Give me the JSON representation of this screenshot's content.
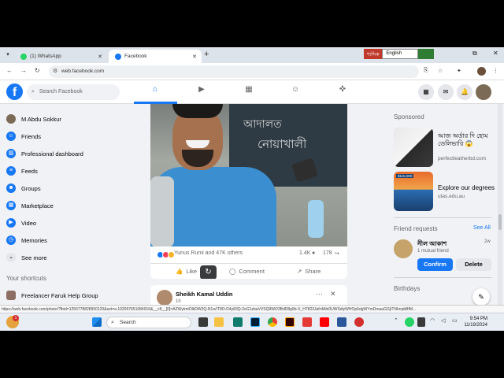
{
  "browser": {
    "tabs": [
      {
        "label": "(1) WhatsApp",
        "favicon_color": "#25d366"
      },
      {
        "label": "Facebook",
        "favicon_color": "#1877f2"
      }
    ],
    "url": "web.facebook.com",
    "ime": {
      "bangla": "শাব্দিক",
      "english": "English"
    },
    "status_url": "https://web.facebook.com/photo/?fbid=1256778828950120&set=a.102097651084916&__cft__[0]=AZWytmtOlkDW2Q-N1o//T8O-D4y83Q-2eG1zbaVVSQ9Wi23BdD8g9b-X_H7823Jafr4Ahi0UWSdiyWHOp6dgWYmDmaaGGjITNImpbBfM..."
  },
  "fb": {
    "brand_color": "#1877f2",
    "search_placeholder": "Search Facebook",
    "sidebar": [
      {
        "label": "M Abdu Sokkur",
        "icon": "avatar",
        "color": "#7b6a55"
      },
      {
        "label": "Friends",
        "icon": "friends-icon",
        "color": "#1877f2"
      },
      {
        "label": "Professional dashboard",
        "icon": "dashboard-icon",
        "color": "#1877f2"
      },
      {
        "label": "Feeds",
        "icon": "feeds-icon",
        "color": "#1877f2"
      },
      {
        "label": "Groups",
        "icon": "groups-icon",
        "color": "#1877f2"
      },
      {
        "label": "Marketplace",
        "icon": "marketplace-icon",
        "color": "#1877f2"
      },
      {
        "label": "Video",
        "icon": "video-icon",
        "color": "#1877f2"
      },
      {
        "label": "Memories",
        "icon": "memories-icon",
        "color": "#1877f2"
      },
      {
        "label": "See more",
        "icon": "chevron-down-icon",
        "color": "#e4e6eb"
      }
    ],
    "shortcuts_heading": "Your shortcuts",
    "shortcuts": [
      {
        "label": "Freelancer Faruk Help Group"
      }
    ],
    "post": {
      "sign_line1": "আদালত",
      "sign_line2": "নোয়াখালী",
      "reactions_text": "Yunus Rumi and 47K others",
      "comments_count": "1.4K",
      "shares_count": "178",
      "like": "Like",
      "comment": "Comment",
      "share": "Share"
    },
    "next_post": {
      "author": "Sheikh Kamal Uddin",
      "time": "1h"
    },
    "sponsored": {
      "heading": "Sponsored",
      "ads": [
        {
          "title": "আজ অর্ডার দি হোম ডেলিভারি 😱",
          "url": "perfectleatherbd.com"
        },
        {
          "title": "Explore our degrees",
          "url": "utas.edu.au",
          "img_text": "$115,000"
        }
      ]
    },
    "friend_requests": {
      "heading": "Friend requests",
      "see_all": "See All",
      "name": "নীল আকাশ",
      "mutual": "1 mutual friend",
      "age": "2w",
      "confirm": "Confirm",
      "delete": "Delete"
    },
    "birthdays_heading": "Birthdays"
  },
  "taskbar": {
    "search_placeholder": "Search",
    "time": "9:54 PM",
    "date": "11/19/2024",
    "notification_count": "1"
  }
}
